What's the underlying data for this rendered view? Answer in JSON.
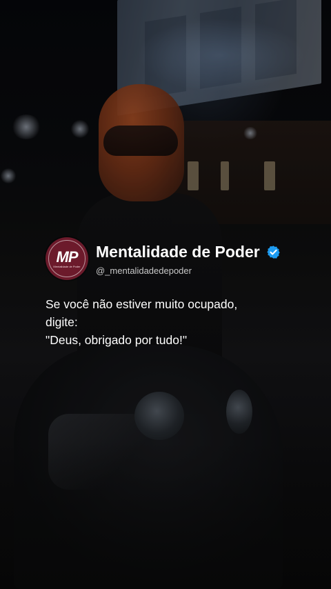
{
  "post": {
    "avatar_monogram": "MP",
    "avatar_subtext": "Mentalidade de Poder",
    "author_name": "Mentalidade de Poder",
    "verified_icon": "verified-badge-icon",
    "handle": "@_mentalidadedepoder",
    "quote_lines": [
      "Se você não estiver muito ocupado,",
      "digite:",
      "\"Deus, obrigado por tudo!\""
    ]
  },
  "colors": {
    "avatar_bg": "#6c1a2b",
    "verified_blue": "#1d9bf0",
    "text_primary": "#ffffff",
    "text_secondary": "#c9c9c9"
  },
  "background": {
    "scene": "night-motorcycle-rider",
    "helmet_color": "#b3532a"
  }
}
